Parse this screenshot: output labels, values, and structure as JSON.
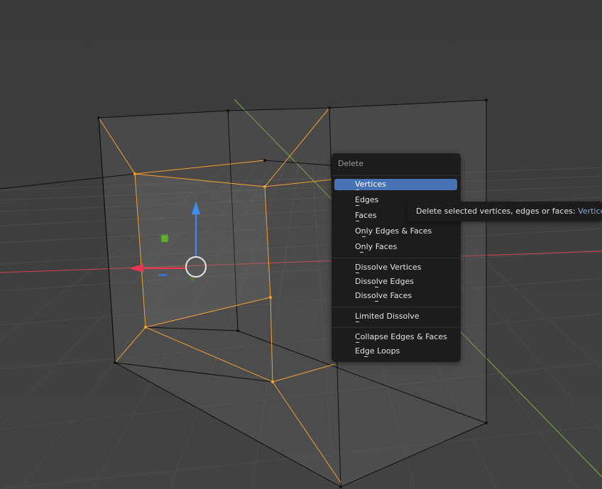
{
  "menu": {
    "title": "Delete",
    "items": [
      {
        "label": "Vertices",
        "selected": true
      },
      {
        "label": "Edges"
      },
      {
        "label": "Faces"
      },
      {
        "label": "Only Edges & Faces"
      },
      {
        "label": "Only Faces"
      },
      {
        "label": "Dissolve Vertices"
      },
      {
        "label": "Dissolve Edges"
      },
      {
        "label": "Dissolve Faces"
      },
      {
        "label": "Limited Dissolve"
      },
      {
        "label": "Collapse Edges & Faces"
      },
      {
        "label": "Edge Loops"
      }
    ]
  },
  "tooltip": {
    "text": "Delete selected vertices, edges or faces:",
    "value": "Vertices"
  },
  "colors": {
    "viewport_bg": "#3d3d3d",
    "grid": "#474747",
    "selection": "#f5a030",
    "x_axis": "#d9434f",
    "y_axis": "#7ab342",
    "gizmo_z": "#3f8df2",
    "gizmo_x": "#f2364d",
    "menu_bg": "#1c1c1c",
    "menu_highlight": "#4772b3"
  }
}
